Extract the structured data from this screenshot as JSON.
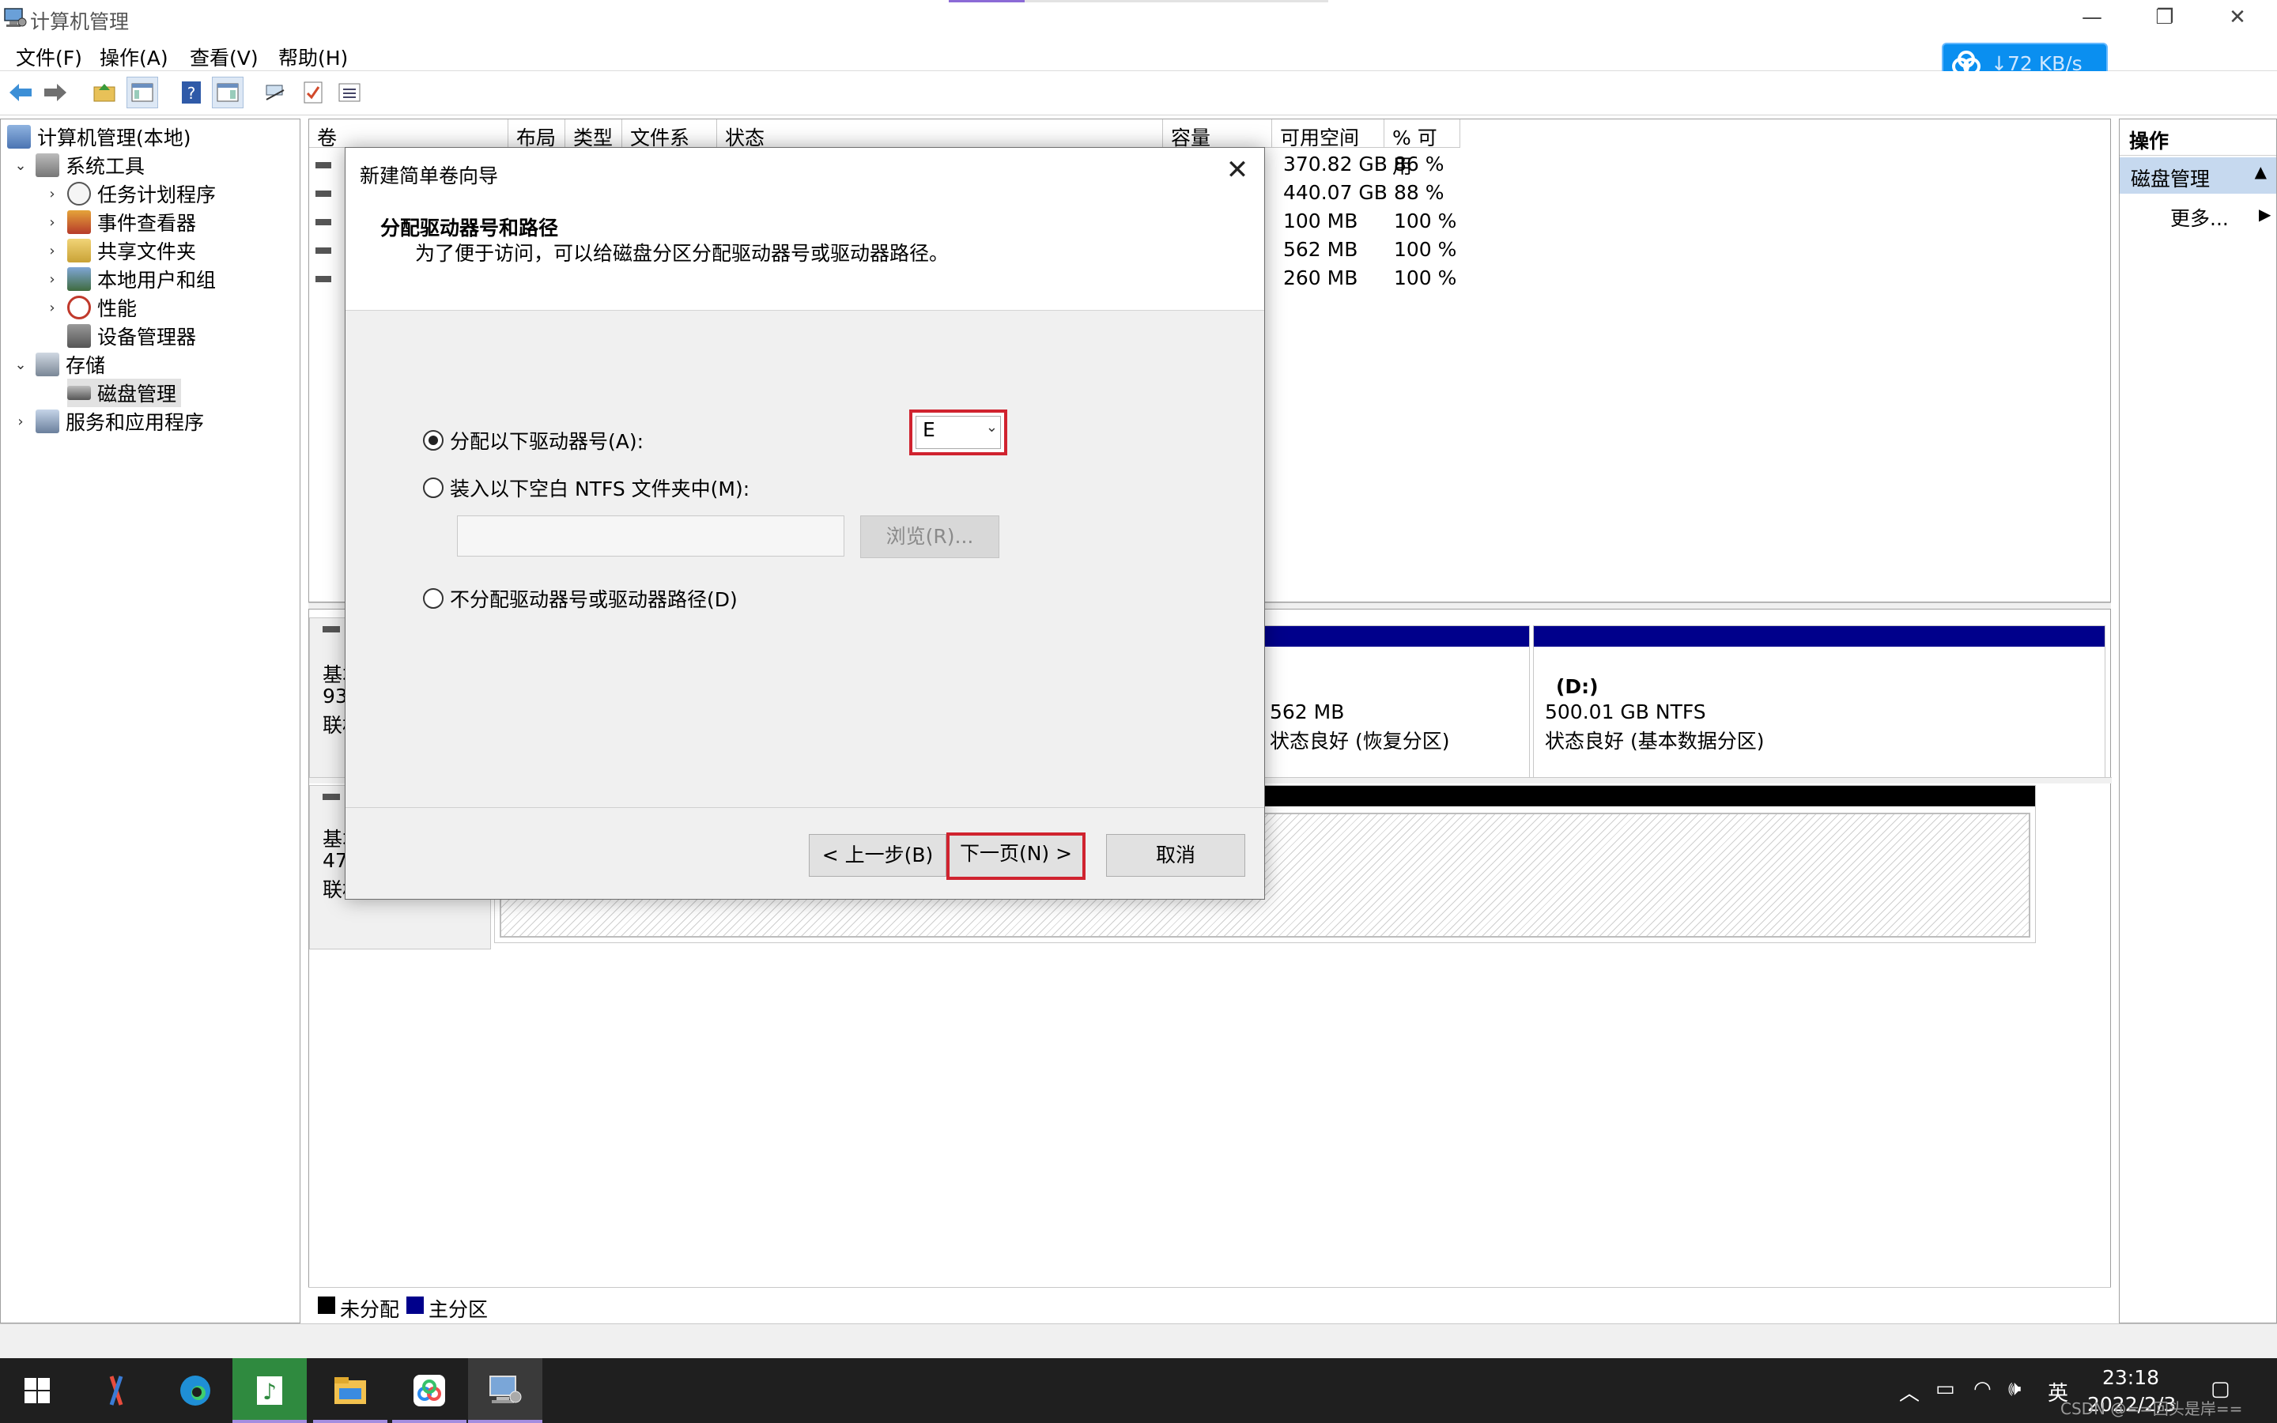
{
  "window": {
    "title": "计算机管理"
  },
  "menu": [
    "文件(F)",
    "操作(A)",
    "查看(V)",
    "帮助(H)"
  ],
  "speed_widget": {
    "text": "72 KB/s"
  },
  "tree": {
    "root": "计算机管理(本地)",
    "system_tools": "系统工具",
    "task_scheduler": "任务计划程序",
    "event_viewer": "事件查看器",
    "shared_folders": "共享文件夹",
    "local_users": "本地用户和组",
    "performance": "性能",
    "device_manager": "设备管理器",
    "storage": "存储",
    "disk_management": "磁盘管理",
    "services": "服务和应用程序"
  },
  "volume_list": {
    "headers": {
      "volume": "卷",
      "layout": "布局",
      "type": "类型",
      "fs": "文件系统",
      "status": "状态",
      "capacity": "容量",
      "free": "可用空间",
      "pct_free": "% 可用"
    },
    "rows": [
      {
        "free": "370.82 GB",
        "pct": "86 %"
      },
      {
        "free": "440.07 GB",
        "pct": "88 %"
      },
      {
        "free": "100 MB",
        "pct": "100 %"
      },
      {
        "free": "562 MB",
        "pct": "100 %"
      },
      {
        "free": "260 MB",
        "pct": "100 %"
      }
    ]
  },
  "disks": {
    "disk0_label_lines": [
      "基本",
      "93",
      "联机"
    ],
    "disk1_label_lines": [
      "基本",
      "47",
      "联机"
    ],
    "recovery": {
      "size": "562 MB",
      "status": "状态良好 (恢复分区)"
    },
    "d_drive": {
      "name": "(D:)",
      "size": "500.01 GB NTFS",
      "status": "状态良好 (基本数据分区)"
    }
  },
  "legend": {
    "unallocated": "未分配",
    "primary": "主分区"
  },
  "actions": {
    "title": "操作",
    "section": "磁盘管理",
    "more": "更多..."
  },
  "dialog": {
    "title": "新建简单卷向导",
    "heading": "分配驱动器号和路径",
    "subheading": "为了便于访问，可以给磁盘分区分配驱动器号或驱动器路径。",
    "option_assign": "分配以下驱动器号(A):",
    "drive_letter": "E",
    "option_mount": "装入以下空白 NTFS 文件夹中(M):",
    "browse": "浏览(R)...",
    "option_none": "不分配驱动器号或驱动器路径(D)",
    "back": "< 上一步(B)",
    "next": "下一页(N) >",
    "cancel": "取消"
  },
  "taskbar": {
    "ime": "英",
    "time": "23:18",
    "date": "2022/2/3"
  },
  "watermark": "CSDN @==回头是岸=="
}
